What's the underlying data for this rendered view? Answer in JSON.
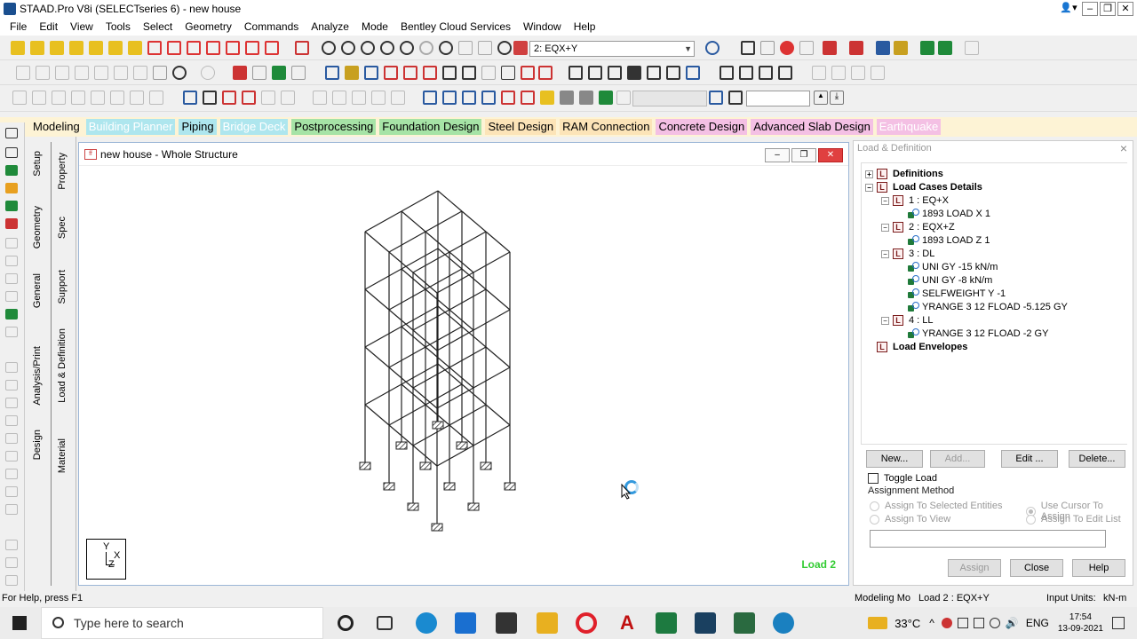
{
  "window": {
    "title": "STAAD.Pro V8i (SELECTseries 6) - new house"
  },
  "menu": [
    "File",
    "Edit",
    "View",
    "Tools",
    "Select",
    "Geometry",
    "Commands",
    "Analyze",
    "Mode",
    "Bentley Cloud Services",
    "Window",
    "Help"
  ],
  "toolbar": {
    "load_case_select": "2: EQX+Y"
  },
  "page_tabs": [
    {
      "label": "Modeling",
      "bg": "#fdf3d5",
      "fg": "#000000"
    },
    {
      "label": "Building Planner",
      "bg": "#aee6ee",
      "fg": "#ffffff"
    },
    {
      "label": "Piping",
      "bg": "#aee6ee",
      "fg": "#000000"
    },
    {
      "label": "Bridge Deck",
      "bg": "#aee6ee",
      "fg": "#ffffff"
    },
    {
      "label": "Postprocessing",
      "bg": "#a6e3a6",
      "fg": "#000000"
    },
    {
      "label": "Foundation Design",
      "bg": "#a6e3a6",
      "fg": "#000000"
    },
    {
      "label": "Steel Design",
      "bg": "#fce4b8",
      "fg": "#000000"
    },
    {
      "label": "RAM Connection",
      "bg": "#fce4b8",
      "fg": "#000000"
    },
    {
      "label": "Concrete Design",
      "bg": "#f4c0e4",
      "fg": "#000000"
    },
    {
      "label": "Advanced Slab Design",
      "bg": "#f4c0e4",
      "fg": "#000000"
    },
    {
      "label": "Earthquake",
      "bg": "#f4c0e4",
      "fg": "#ffffff"
    }
  ],
  "side_tabs": {
    "outer": [
      "Design",
      "Analysis/Print",
      "General",
      "Geometry",
      "Setup"
    ],
    "inner": [
      "Material",
      "Load & Definition",
      "Support",
      "Spec",
      "Property"
    ]
  },
  "view_window": {
    "title": "new house - Whole Structure",
    "load_label": "Load 2",
    "axis": {
      "y": "Y",
      "x": "X",
      "z": "Z"
    }
  },
  "panel": {
    "title": "Load & Definition",
    "tree": [
      {
        "label": "Definitions",
        "bold": true,
        "icon": "L",
        "level": 0,
        "exp": "+"
      },
      {
        "label": "Load Cases Details",
        "bold": true,
        "icon": "L",
        "level": 0,
        "exp": "−"
      },
      {
        "label": "1 : EQ+X",
        "icon": "L",
        "level": 1,
        "exp": "−"
      },
      {
        "label": "1893 LOAD X 1",
        "icon": "load",
        "level": 2
      },
      {
        "label": "2 : EQX+Z",
        "icon": "L",
        "level": 1,
        "exp": "−"
      },
      {
        "label": "1893 LOAD Z 1",
        "icon": "load",
        "level": 2
      },
      {
        "label": "3 : DL",
        "icon": "L",
        "level": 1,
        "exp": "−"
      },
      {
        "label": "UNI GY -15 kN/m",
        "icon": "load",
        "level": 2
      },
      {
        "label": "UNI GY -8 kN/m",
        "icon": "load",
        "level": 2
      },
      {
        "label": "SELFWEIGHT Y -1",
        "icon": "load",
        "level": 2
      },
      {
        "label": "YRANGE 3 12 FLOAD -5.125 GY",
        "icon": "load",
        "level": 2
      },
      {
        "label": "4 : LL",
        "icon": "L",
        "level": 1,
        "exp": "−"
      },
      {
        "label": "YRANGE 3 12 FLOAD -2 GY",
        "icon": "load",
        "level": 2
      },
      {
        "label": "Load Envelopes",
        "bold": true,
        "icon": "L",
        "level": 0
      }
    ],
    "buttons": {
      "new": "New...",
      "add": "Add...",
      "edit": "Edit ...",
      "delete": "Delete..."
    },
    "toggle_load": "Toggle Load",
    "assignment_method": "Assignment Method",
    "radios": {
      "selected_entities": "Assign To Selected Entities",
      "view": "Assign To View",
      "cursor": "Use Cursor To Assign",
      "edit_list": "Assign To Edit List"
    },
    "bottom_buttons": {
      "assign": "Assign",
      "close": "Close",
      "help": "Help"
    }
  },
  "status": {
    "help": "For Help, press F1",
    "mode": "Modeling Mo",
    "load": "Load 2 : EQX+Y",
    "input_units": "Input Units:",
    "units": "kN-m"
  },
  "taskbar": {
    "search_placeholder": "Type here to search",
    "temperature": "33°C",
    "language": "ENG",
    "time": "17:54",
    "date": "13-09-2021"
  }
}
